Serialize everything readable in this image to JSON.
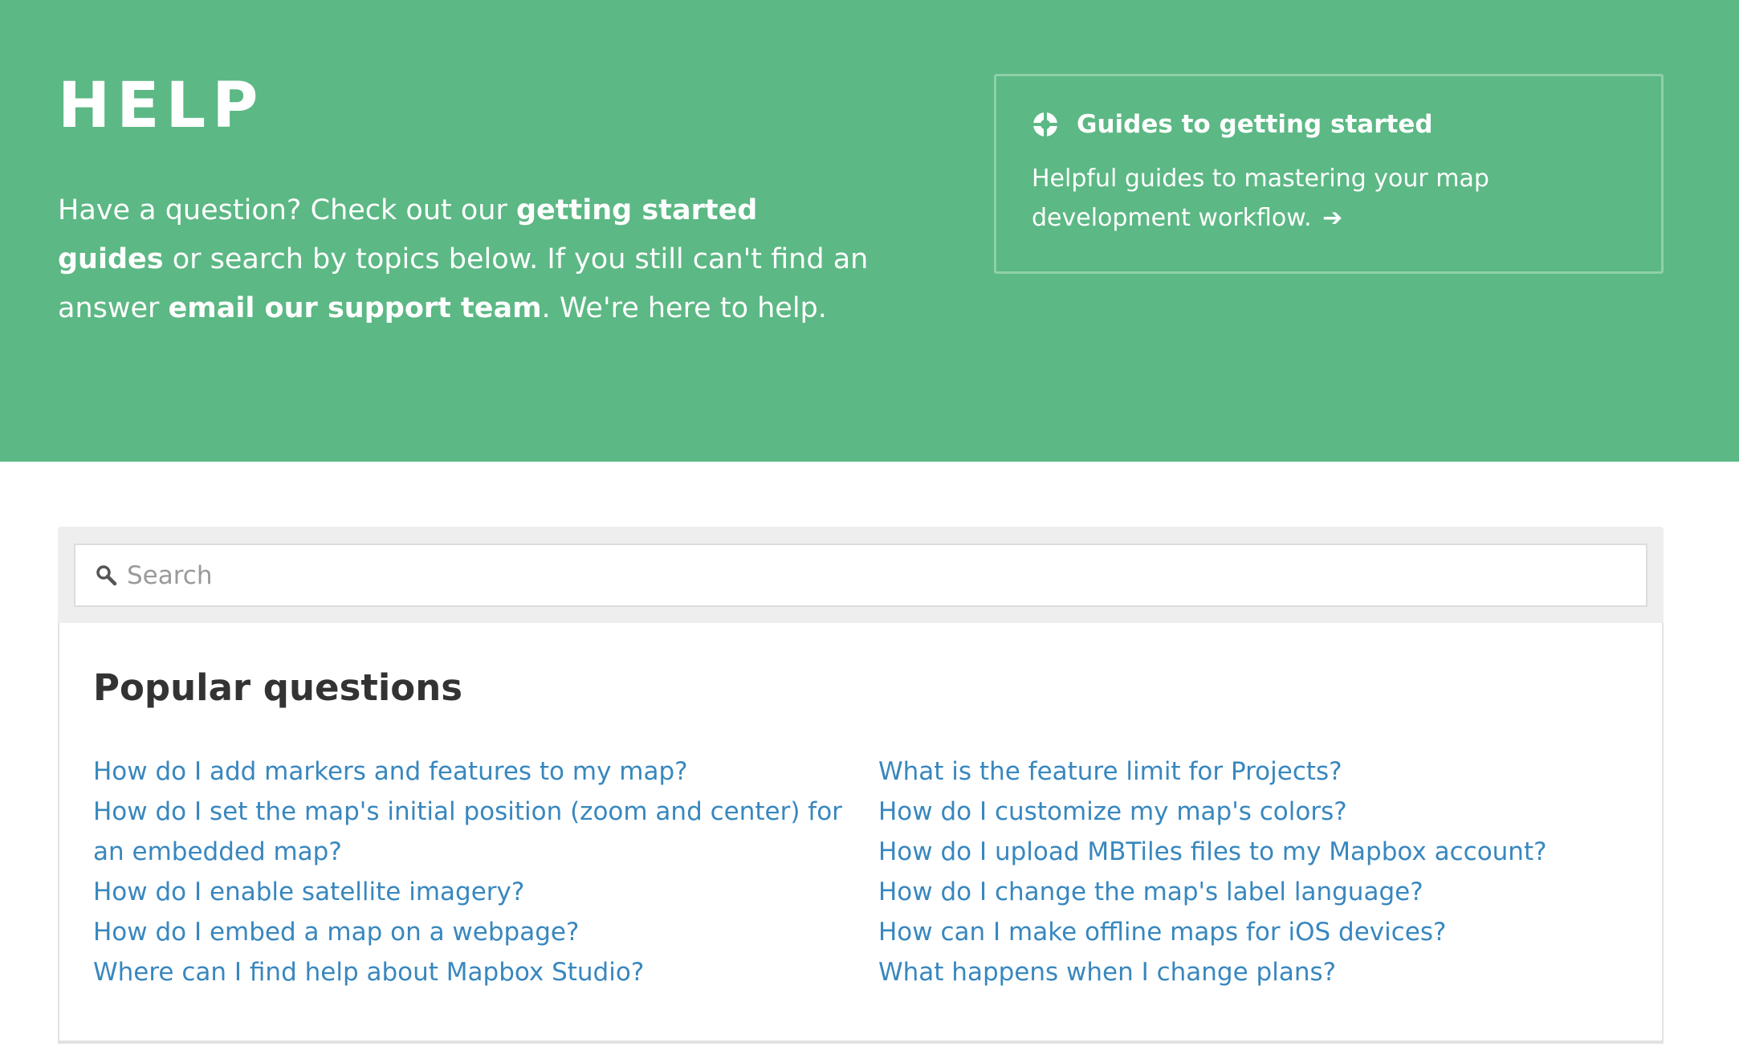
{
  "hero": {
    "title": "HELP",
    "intro_1": "Have a question? Check out our ",
    "guides_link": "getting started guides",
    "intro_2": " or search by topics below. If you still can't find an answer ",
    "support_link": "email our support team",
    "intro_3": ". We're here to help."
  },
  "guide_card": {
    "icon": "compass-icon",
    "title": "Guides to getting started",
    "description": "Helpful guides to mastering your map development workflow.",
    "arrow": "➔"
  },
  "search": {
    "icon": "search-icon",
    "placeholder": "Search",
    "value": ""
  },
  "popular": {
    "title": "Popular questions",
    "left": [
      "How do I add markers and features to my map?",
      "How do I set the map's initial position (zoom and center) for an embedded map?",
      "How do I enable satellite imagery?",
      "How do I embed a map on a webpage?",
      "Where can I find help about Mapbox Studio?"
    ],
    "right": [
      "What is the feature limit for Projects?",
      "How do I customize my map's colors?",
      "How do I upload MBTiles files to my Mapbox account?",
      "How do I change the map's label language?",
      "How can I make offline maps for iOS devices?",
      "What happens when I change plans?"
    ]
  },
  "colors": {
    "hero_bg": "#5cb884",
    "link": "#3887be",
    "heading": "#333333"
  }
}
